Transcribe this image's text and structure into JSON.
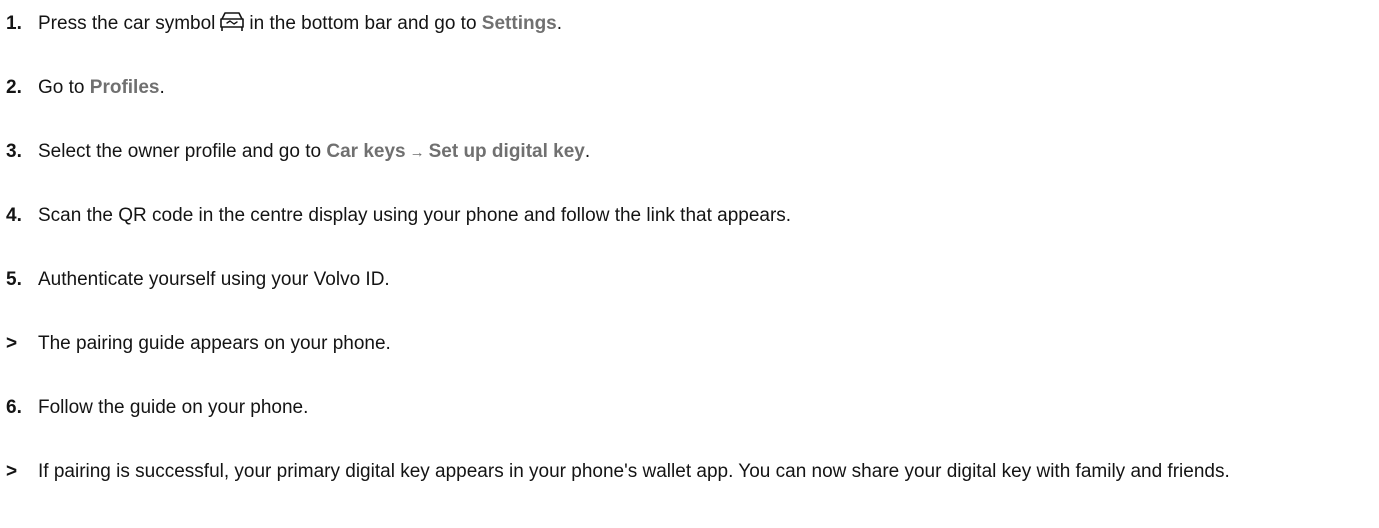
{
  "steps": [
    {
      "marker": "1.",
      "before": "Press the car symbol",
      "icon": "car-icon",
      "after": "in the bottom bar and go to",
      "term": "Settings",
      "end": "."
    },
    {
      "marker": "2.",
      "before": "Go to",
      "term": "Profiles",
      "end": "."
    },
    {
      "marker": "3.",
      "before": "Select the owner profile and go to",
      "term1": "Car keys",
      "arrow": "→",
      "term2": "Set up digital key",
      "end": "."
    },
    {
      "marker": "4.",
      "text": "Scan the QR code in the centre display using your phone and follow the link that appears."
    },
    {
      "marker": "5.",
      "text": "Authenticate yourself using your Volvo ID."
    },
    {
      "marker": ">",
      "text": "The pairing guide appears on your phone."
    },
    {
      "marker": "6.",
      "text": "Follow the guide on your phone."
    },
    {
      "marker": ">",
      "text": "If pairing is successful, your primary digital key appears in your phone's wallet app. You can now share your digital key with family and friends."
    }
  ],
  "colors": {
    "text": "#141414",
    "ui_term": "#707070",
    "background": "#ffffff"
  }
}
